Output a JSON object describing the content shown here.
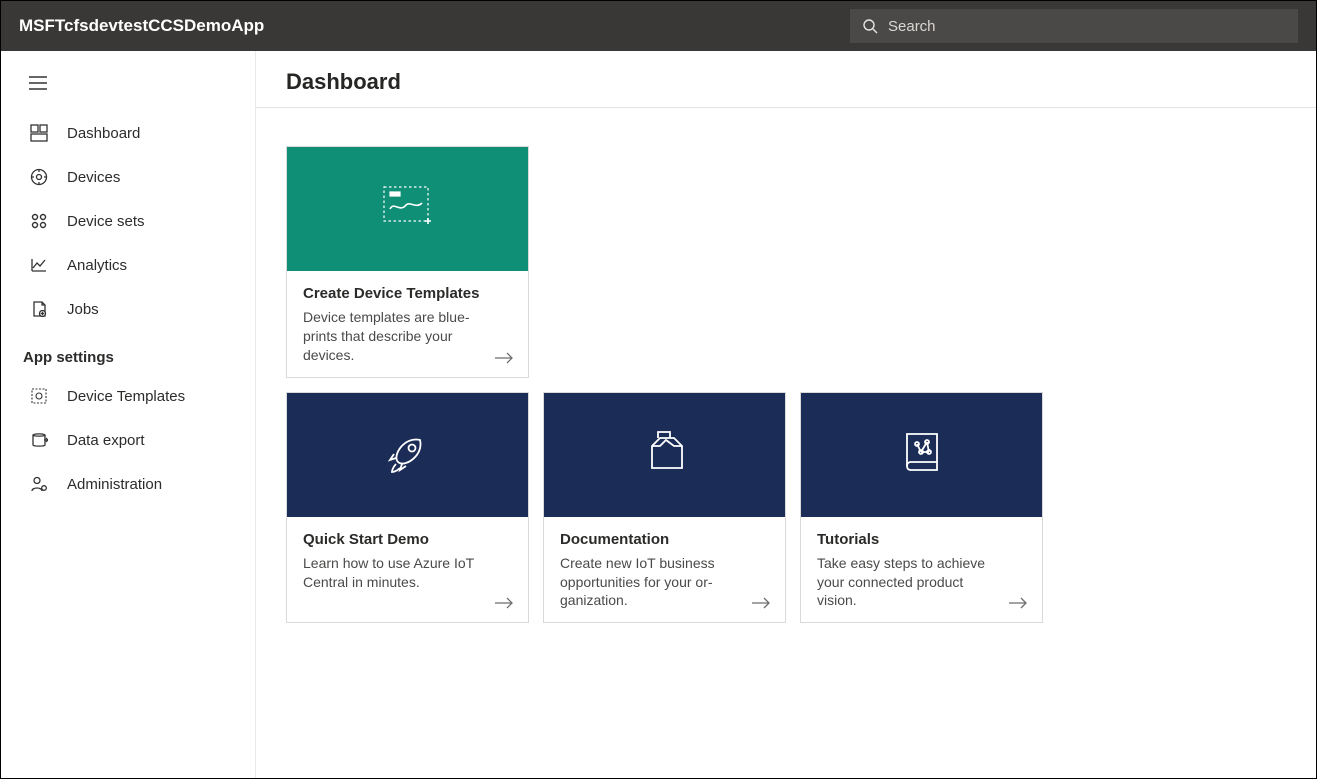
{
  "header": {
    "app_title": "MSFTcfsdevtestCCSDemoApp",
    "search_placeholder": "Search"
  },
  "sidebar": {
    "items": [
      {
        "label": "Dashboard",
        "icon": "dashboard-icon"
      },
      {
        "label": "Devices",
        "icon": "devices-icon"
      },
      {
        "label": "Device sets",
        "icon": "device-sets-icon"
      },
      {
        "label": "Analytics",
        "icon": "analytics-icon"
      },
      {
        "label": "Jobs",
        "icon": "jobs-icon"
      }
    ],
    "section_label": "App settings",
    "settings_items": [
      {
        "label": "Device Templates",
        "icon": "device-templates-icon"
      },
      {
        "label": "Data export",
        "icon": "data-export-icon"
      },
      {
        "label": "Administration",
        "icon": "administration-icon"
      }
    ]
  },
  "main": {
    "page_title": "Dashboard",
    "cards": [
      {
        "title": "Create Device Templates",
        "desc": "Device templates are blue­prints that describe your devices.",
        "hero_color": "teal",
        "icon": "template-icon"
      },
      {
        "title": "Quick Start Demo",
        "desc": "Learn how to use Azure IoT Central in minutes.",
        "hero_color": "navy",
        "icon": "rocket-icon"
      },
      {
        "title": "Documentation",
        "desc": "Create new IoT business opportunities for your or­ganization.",
        "hero_color": "navy",
        "icon": "docs-icon"
      },
      {
        "title": "Tutorials",
        "desc": "Take easy steps to achieve your connected product vision.",
        "hero_color": "navy",
        "icon": "tutorials-icon"
      }
    ]
  }
}
